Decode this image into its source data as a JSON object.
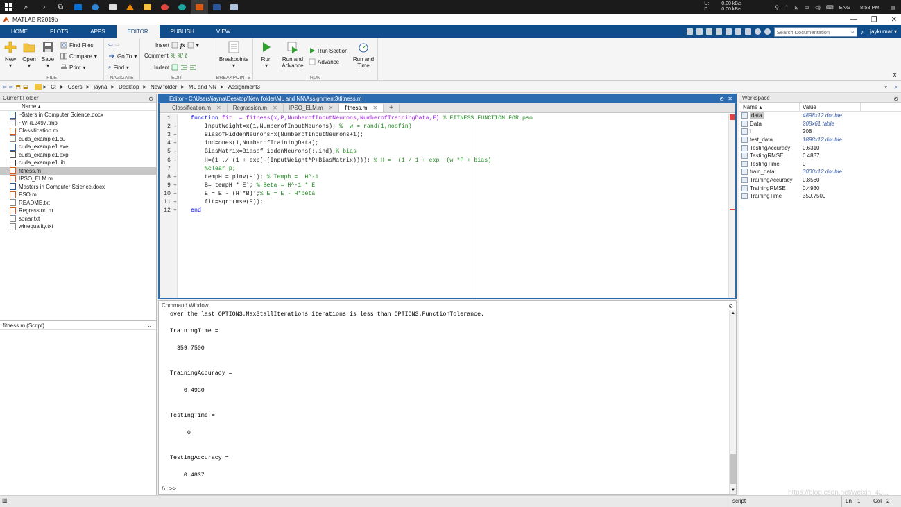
{
  "taskbar": {
    "net": {
      "up_label": "U:",
      "up": "0.00 kB/s",
      "down_label": "D:",
      "down": "0.00 kB/s"
    },
    "lang": "ENG",
    "time": "8:58 PM"
  },
  "window": {
    "title": "MATLAB R2019b",
    "minimize": "—",
    "restore": "❐",
    "close": "✕"
  },
  "ribbon_tabs": [
    "HOME",
    "PLOTS",
    "APPS",
    "EDITOR",
    "PUBLISH",
    "VIEW"
  ],
  "search": {
    "placeholder": "Search Documentation"
  },
  "user": "jaykumar ▾",
  "ribbon": {
    "file": {
      "label": "FILE",
      "new": "New",
      "open": "Open",
      "save": "Save",
      "find_files": "Find Files",
      "compare": "Compare",
      "print": "Print"
    },
    "navigate": {
      "label": "NAVIGATE",
      "goto": "Go To",
      "find": "Find"
    },
    "edit": {
      "label": "EDIT",
      "insert": "Insert",
      "comment": "Comment",
      "indent": "Indent",
      "fx": "fx"
    },
    "breakpoints": {
      "label": "BREAKPOINTS",
      "breakpoints": "Breakpoints"
    },
    "run": {
      "label": "RUN",
      "run": "Run",
      "run_advance": "Run and Advance",
      "run_section": "Run Section",
      "advance": "Advance",
      "run_time": "Run and Time"
    }
  },
  "address": {
    "path": [
      "C:",
      "Users",
      "jayna",
      "Desktop",
      "New folder",
      "ML and NN",
      "Assignment3"
    ]
  },
  "current_folder": {
    "title": "Current Folder",
    "column": "Name ▴",
    "files": [
      {
        "name": "~$sters in Computer Science.docx",
        "selected": false
      },
      {
        "name": "~WRL2497.tmp",
        "selected": false
      },
      {
        "name": "Classification.m",
        "selected": false
      },
      {
        "name": "cuda_example1.cu",
        "selected": false
      },
      {
        "name": "cuda_example1.exe",
        "selected": false
      },
      {
        "name": "cuda_example1.exp",
        "selected": false
      },
      {
        "name": "cuda_example1.lib",
        "selected": false
      },
      {
        "name": "fitness.m",
        "selected": true
      },
      {
        "name": "IPSO_ELM.m",
        "selected": false
      },
      {
        "name": "Masters in Computer Science.docx",
        "selected": false
      },
      {
        "name": "PSO.m",
        "selected": false
      },
      {
        "name": "README.txt",
        "selected": false
      },
      {
        "name": "Regrassion.m",
        "selected": false
      },
      {
        "name": "sonar.txt",
        "selected": false
      },
      {
        "name": "winequality.txt",
        "selected": false
      }
    ],
    "details": "fitness.m  (Script)"
  },
  "editor": {
    "title": "Editor - C:\\Users\\jayna\\Desktop\\New folder\\ML and NN\\Assignment3\\fitness.m",
    "tabs": [
      "Classification.m",
      "Regrassion.m",
      "IPSO_ELM.m",
      "fitness.m"
    ],
    "active_tab": "fitness.m",
    "add_tab": "+",
    "lines": [
      {
        "n": "1",
        "d": "",
        "parts": [
          {
            "t": "function",
            "c": "kw"
          },
          {
            "t": " fit  = fitness(x,P,NumberofInputNeurons,NumberofTrainingData,E)",
            "c": "str"
          },
          {
            "t": " % FITNESS FUNCTION FOR pso",
            "c": "cm"
          }
        ]
      },
      {
        "n": "2",
        "d": "–",
        "parts": [
          {
            "t": "    InputWeight=x(1,NumberofInputNeurons); ",
            "c": ""
          },
          {
            "t": "%  w = rand(1,noofin)",
            "c": "cm"
          }
        ]
      },
      {
        "n": "3",
        "d": "–",
        "parts": [
          {
            "t": "    BiasofHiddenNeurons=x(NumberofInputNeurons+1);",
            "c": ""
          }
        ]
      },
      {
        "n": "4",
        "d": "–",
        "parts": [
          {
            "t": "    ind=ones(1,NumberofTrainingData);",
            "c": ""
          }
        ]
      },
      {
        "n": "5",
        "d": "–",
        "parts": [
          {
            "t": "    BiasMatrix=BiasofHiddenNeurons(:,ind);",
            "c": ""
          },
          {
            "t": "% bias",
            "c": "cm"
          }
        ]
      },
      {
        "n": "6",
        "d": "–",
        "parts": [
          {
            "t": "    H=(1 ./ (1 + exp(-(InputWeight*P+BiasMatrix)))); ",
            "c": ""
          },
          {
            "t": "% H =  (1 / 1 + exp  (w *P + bias)",
            "c": "cm"
          }
        ]
      },
      {
        "n": "7",
        "d": "",
        "parts": [
          {
            "t": "    %clear p;",
            "c": "cm"
          }
        ]
      },
      {
        "n": "8",
        "d": "–",
        "parts": [
          {
            "t": "    tempH = pinv(H'); ",
            "c": ""
          },
          {
            "t": "% Temph =  H^-1",
            "c": "cm"
          }
        ]
      },
      {
        "n": "9",
        "d": "–",
        "parts": [
          {
            "t": "    B= tempH * E'; ",
            "c": ""
          },
          {
            "t": "% Beta = H^-1 * E",
            "c": "cm"
          }
        ]
      },
      {
        "n": "10",
        "d": "–",
        "parts": [
          {
            "t": "    E = E - (H'*B)';",
            "c": ""
          },
          {
            "t": "% E = E - H*beta",
            "c": "cm"
          }
        ]
      },
      {
        "n": "11",
        "d": "–",
        "parts": [
          {
            "t": "    fit=sqrt(mse(E));",
            "c": ""
          }
        ]
      },
      {
        "n": "12",
        "d": "–",
        "parts": [
          {
            "t": "end",
            "c": "kw"
          }
        ]
      }
    ]
  },
  "command_window": {
    "title": "Command Window",
    "output": "over the last OPTIONS.MaxStallIterations iterations is less than OPTIONS.FunctionTolerance.\n\nTrainingTime =\n\n  359.7500\n\n\nTrainingAccuracy =\n\n    0.4930\n\n\nTestingTime =\n\n     0\n\n\nTestingAccuracy =\n\n    0.4837\n",
    "prompt": ">>",
    "fx": "fx"
  },
  "workspace": {
    "title": "Workspace",
    "columns": [
      "Name ▴",
      "Value"
    ],
    "vars": [
      {
        "name": "data",
        "value": "4898x12 double",
        "italic": true,
        "selected": true
      },
      {
        "name": "Data",
        "value": "208x61 table",
        "italic": true,
        "selected": false
      },
      {
        "name": "i",
        "value": "208",
        "italic": false,
        "selected": false
      },
      {
        "name": "test_data",
        "value": "1898x12 double",
        "italic": true,
        "selected": false
      },
      {
        "name": "TestingAccuracy",
        "value": "0.6310",
        "italic": false,
        "selected": false
      },
      {
        "name": "TestingRMSE",
        "value": "0.4837",
        "italic": false,
        "selected": false
      },
      {
        "name": "TestingTime",
        "value": "0",
        "italic": false,
        "selected": false
      },
      {
        "name": "train_data",
        "value": "3000x12 double",
        "italic": true,
        "selected": false
      },
      {
        "name": "TrainingAccuracy",
        "value": "0.8560",
        "italic": false,
        "selected": false
      },
      {
        "name": "TrainingRMSE",
        "value": "0.4930",
        "italic": false,
        "selected": false
      },
      {
        "name": "TrainingTime",
        "value": "359.7500",
        "italic": false,
        "selected": false
      }
    ]
  },
  "status": {
    "type": "script",
    "ln_label": "Ln",
    "ln": "1",
    "col_label": "Col",
    "col": "2",
    "watermark": "https://blog.csdn.net/weixin_43..."
  },
  "colors": {
    "ribbon_blue": "#104e8b",
    "editor_border": "#2d6bb0",
    "keyword": "#0000ff",
    "comment": "#228b22",
    "string": "#a020f0"
  }
}
